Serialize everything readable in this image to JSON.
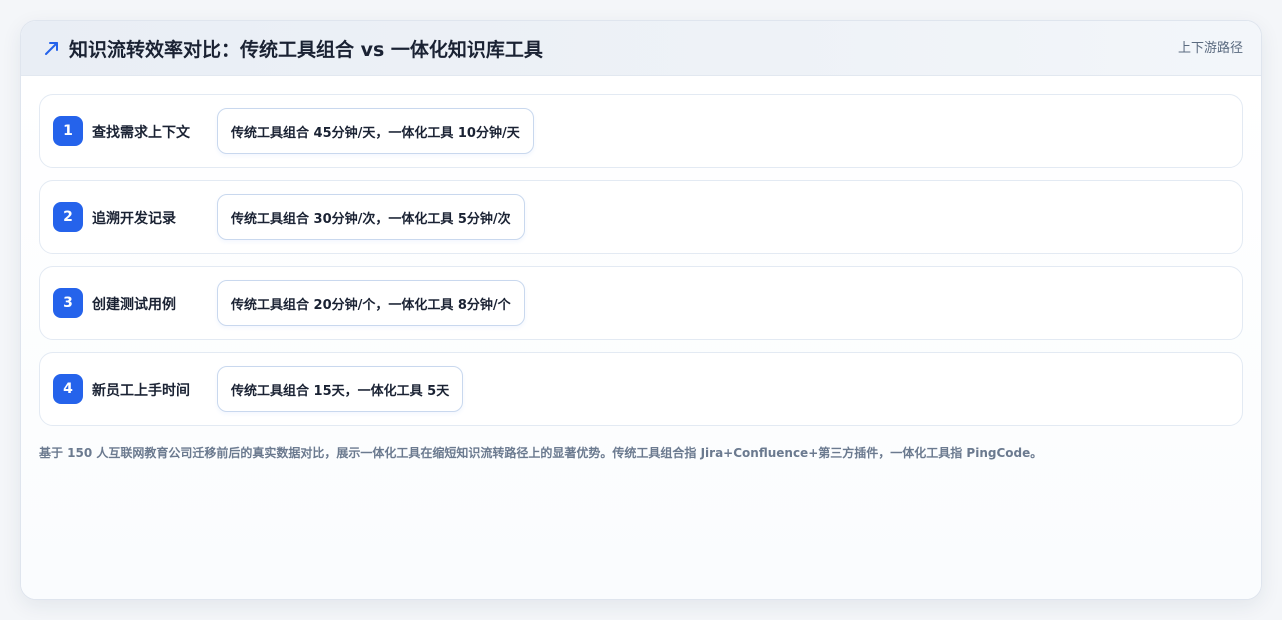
{
  "header": {
    "title": "知识流转效率对比：传统工具组合 vs 一体化知识库工具",
    "tag": "上下游路径",
    "icon": "trend-up-icon",
    "accent_color": "#2563eb"
  },
  "steps": [
    {
      "number": "1",
      "label": "查找需求上下文",
      "comparison": "传统工具组合 45分钟/天，一体化工具 10分钟/天"
    },
    {
      "number": "2",
      "label": "追溯开发记录",
      "comparison": "传统工具组合 30分钟/次，一体化工具 5分钟/次"
    },
    {
      "number": "3",
      "label": "创建测试用例",
      "comparison": "传统工具组合 20分钟/个，一体化工具 8分钟/个"
    },
    {
      "number": "4",
      "label": "新员工上手时间",
      "comparison": "传统工具组合 15天，一体化工具 5天"
    }
  ],
  "footnote": "基于 150 人互联网教育公司迁移前后的真实数据对比，展示一体化工具在缩短知识流转路径上的显著优势。传统工具组合指 Jira+Confluence+第三方插件，一体化工具指 PingCode。"
}
